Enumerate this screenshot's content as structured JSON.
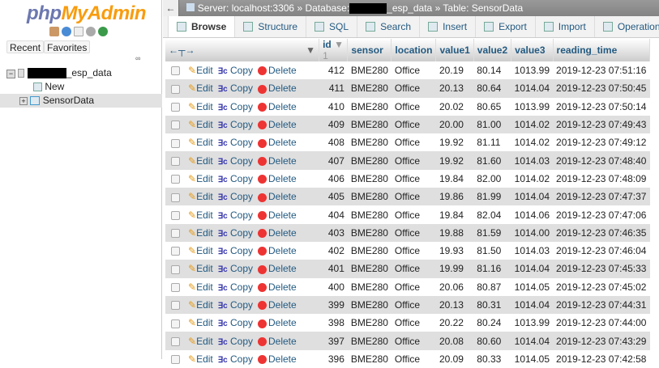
{
  "sidebar": {
    "logo_a": "php",
    "logo_b": "MyAdmin",
    "recent": "Recent",
    "favorites": "Favorites",
    "db_suffix": "_esp_data",
    "new": "New",
    "table": "SensorData"
  },
  "breadcrumb": {
    "server": "Server: localhost:3306",
    "sep": "»",
    "database": "Database:",
    "db_suffix": "_esp_data",
    "table": "Table: SensorData"
  },
  "tabs": [
    "Browse",
    "Structure",
    "SQL",
    "Search",
    "Insert",
    "Export",
    "Import",
    "Operations"
  ],
  "columns": [
    "id",
    "sensor",
    "location",
    "value1",
    "value2",
    "value3",
    "reading_time"
  ],
  "sort_indicator": "1",
  "actions": {
    "edit": "Edit",
    "copy": "Copy",
    "delete": "Delete"
  },
  "rows": [
    [
      "412",
      "BME280",
      "Office",
      "20.19",
      "80.14",
      "1013.99",
      "2019-12-23 07:51:16"
    ],
    [
      "411",
      "BME280",
      "Office",
      "20.13",
      "80.64",
      "1014.04",
      "2019-12-23 07:50:45"
    ],
    [
      "410",
      "BME280",
      "Office",
      "20.02",
      "80.65",
      "1013.99",
      "2019-12-23 07:50:14"
    ],
    [
      "409",
      "BME280",
      "Office",
      "20.00",
      "81.00",
      "1014.02",
      "2019-12-23 07:49:43"
    ],
    [
      "408",
      "BME280",
      "Office",
      "19.92",
      "81.11",
      "1014.02",
      "2019-12-23 07:49:12"
    ],
    [
      "407",
      "BME280",
      "Office",
      "19.92",
      "81.60",
      "1014.03",
      "2019-12-23 07:48:40"
    ],
    [
      "406",
      "BME280",
      "Office",
      "19.84",
      "82.00",
      "1014.02",
      "2019-12-23 07:48:09"
    ],
    [
      "405",
      "BME280",
      "Office",
      "19.86",
      "81.99",
      "1014.04",
      "2019-12-23 07:47:37"
    ],
    [
      "404",
      "BME280",
      "Office",
      "19.84",
      "82.04",
      "1014.06",
      "2019-12-23 07:47:06"
    ],
    [
      "403",
      "BME280",
      "Office",
      "19.88",
      "81.59",
      "1014.00",
      "2019-12-23 07:46:35"
    ],
    [
      "402",
      "BME280",
      "Office",
      "19.93",
      "81.50",
      "1014.03",
      "2019-12-23 07:46:04"
    ],
    [
      "401",
      "BME280",
      "Office",
      "19.99",
      "81.16",
      "1014.04",
      "2019-12-23 07:45:33"
    ],
    [
      "400",
      "BME280",
      "Office",
      "20.06",
      "80.87",
      "1014.05",
      "2019-12-23 07:45:02"
    ],
    [
      "399",
      "BME280",
      "Office",
      "20.13",
      "80.31",
      "1014.04",
      "2019-12-23 07:44:31"
    ],
    [
      "398",
      "BME280",
      "Office",
      "20.22",
      "80.24",
      "1013.99",
      "2019-12-23 07:44:00"
    ],
    [
      "397",
      "BME280",
      "Office",
      "20.08",
      "80.60",
      "1014.04",
      "2019-12-23 07:43:29"
    ],
    [
      "396",
      "BME280",
      "Office",
      "20.09",
      "80.33",
      "1014.05",
      "2019-12-23 07:42:58"
    ]
  ]
}
